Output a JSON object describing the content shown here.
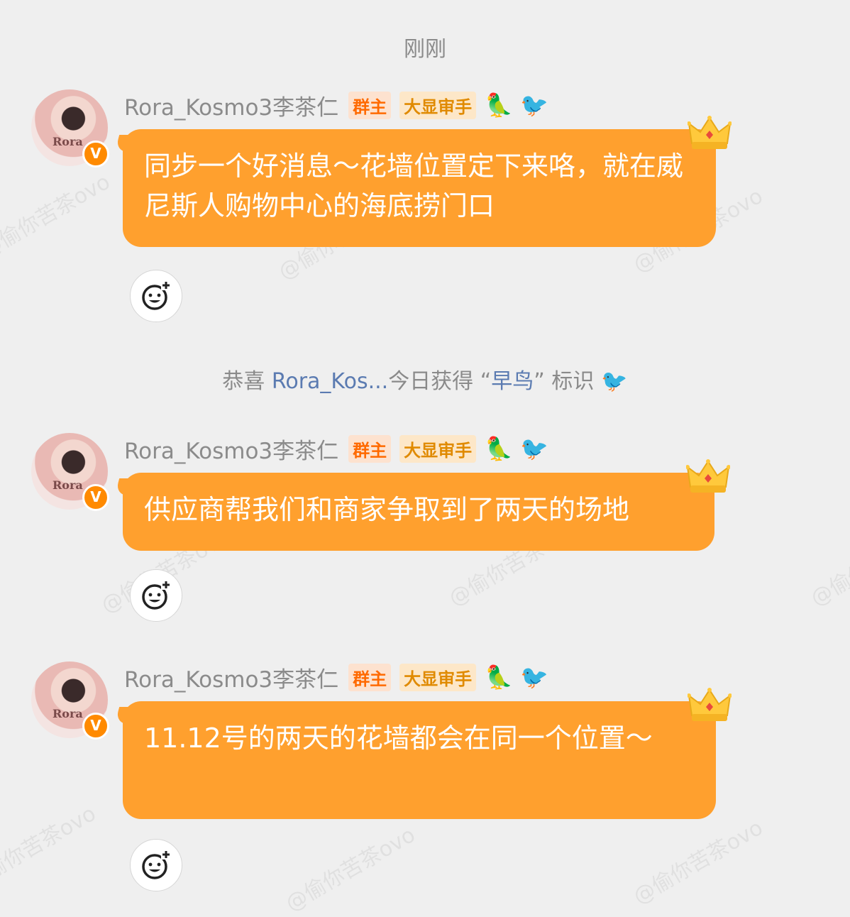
{
  "timestamp": "刚刚",
  "watermark": "@偷你苦茶ovo",
  "system_notice": {
    "prefix": "恭喜 ",
    "user": "Rora_Kos...",
    "middle": "今日获得 “",
    "badge": "早鸟",
    "suffix": "” 标识",
    "bird_icon": "🐦"
  },
  "messages": [
    {
      "username": "Rora_Kosmo3李茶仁",
      "tag_owner": "群主",
      "tag_role": "大显审手",
      "badge_v": "V",
      "avatar_text": "Rora",
      "emoji_parrot": "🦜",
      "emoji_bird": "🐦",
      "text": "同步一个好消息～花墙位置定下来咯，就在威尼斯人购物中心的海底捞门口"
    },
    {
      "username": "Rora_Kosmo3李茶仁",
      "tag_owner": "群主",
      "tag_role": "大显审手",
      "badge_v": "V",
      "avatar_text": "Rora",
      "emoji_parrot": "🦜",
      "emoji_bird": "🐦",
      "text": "供应商帮我们和商家争取到了两天的场地"
    },
    {
      "username": "Rora_Kosmo3李茶仁",
      "tag_owner": "群主",
      "tag_role": "大显审手",
      "badge_v": "V",
      "avatar_text": "Rora",
      "emoji_parrot": "🦜",
      "emoji_bird": "🐦",
      "text": "11.12号的两天的花墙都会在同一个位置～"
    }
  ],
  "colors": {
    "bubble": "#ffa02e",
    "background": "#efefef",
    "owner_tag": "#ff6a00",
    "role_tag": "#e08a00",
    "link": "#5b7bb1"
  },
  "icons": {
    "react": "smiley-plus-icon",
    "crown": "crown-icon",
    "verified": "verified-v-icon"
  }
}
